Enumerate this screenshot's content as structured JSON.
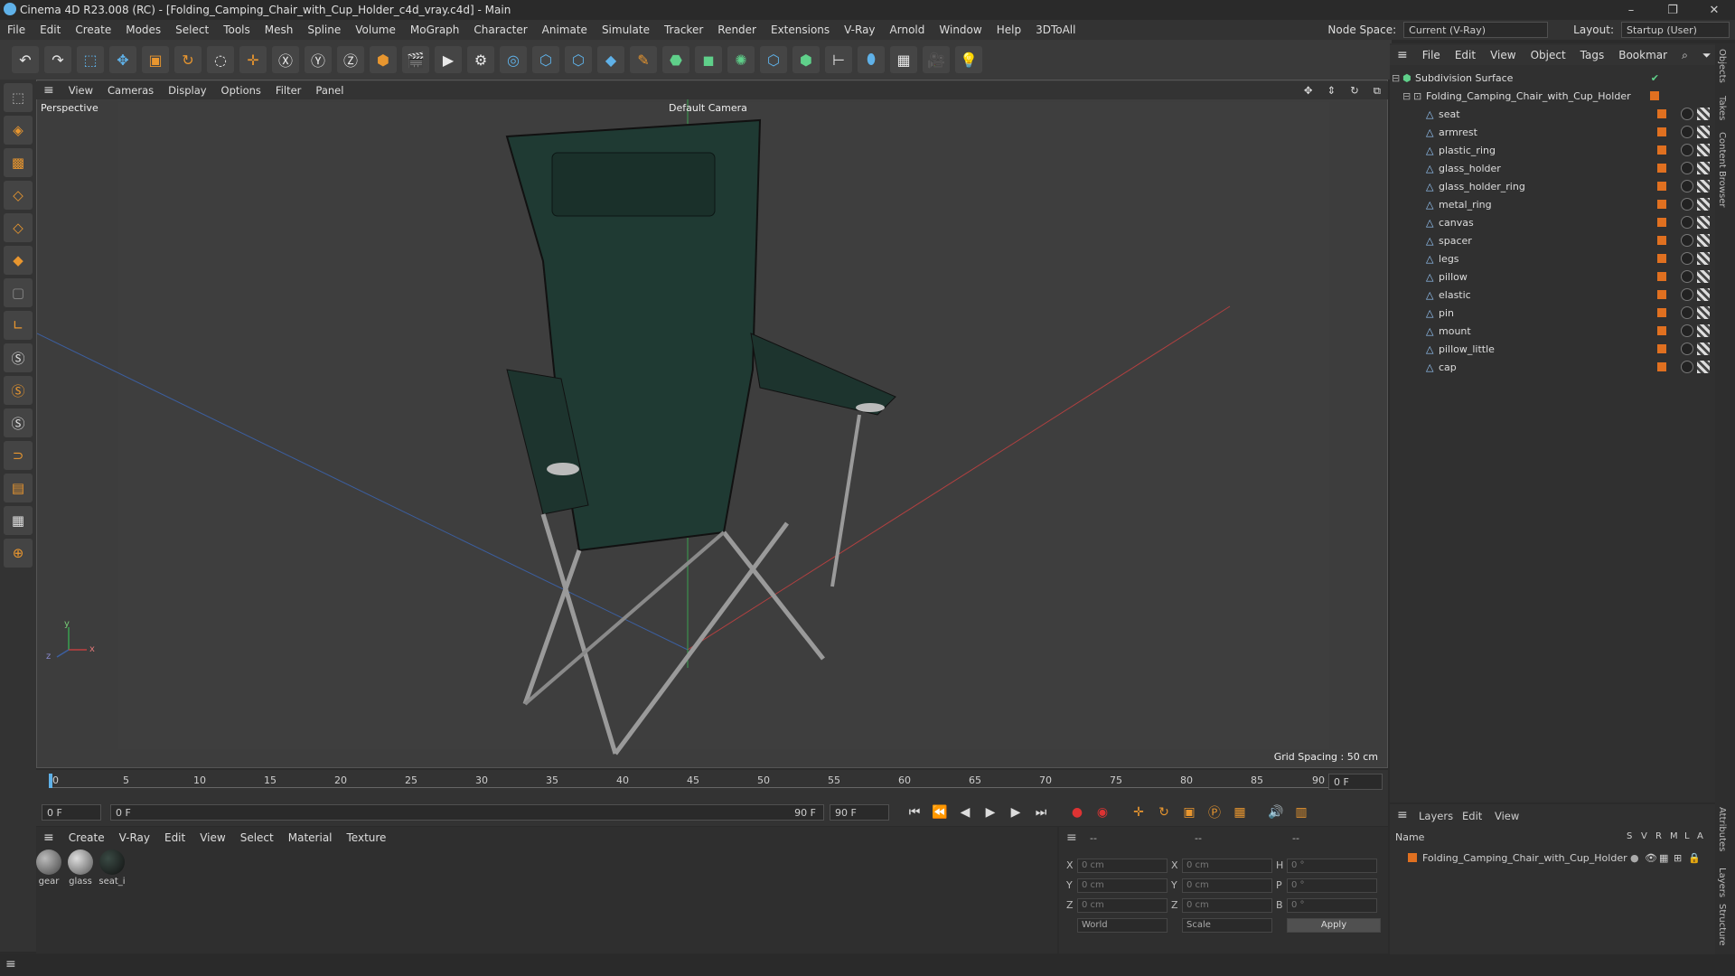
{
  "window": {
    "title": "Cinema 4D R23.008 (RC) - [Folding_Camping_Chair_with_Cup_Holder_c4d_vray.c4d] - Main",
    "minimize": "–",
    "restore": "❐",
    "close": "✕"
  },
  "menu": [
    "File",
    "Edit",
    "Create",
    "Modes",
    "Select",
    "Tools",
    "Mesh",
    "Spline",
    "Volume",
    "MoGraph",
    "Character",
    "Animate",
    "Simulate",
    "Tracker",
    "Render",
    "Extensions",
    "V-Ray",
    "Arnold",
    "Window",
    "Help",
    "3DToAll"
  ],
  "nodespace": {
    "label": "Node Space:",
    "value": "Current (V-Ray)"
  },
  "layout": {
    "label": "Layout:",
    "value": "Startup (User)"
  },
  "viewport": {
    "menu": [
      "View",
      "Cameras",
      "Display",
      "Options",
      "Filter",
      "Panel"
    ],
    "name": "Perspective",
    "camera": "Default Camera",
    "grid": "Grid Spacing : 50 cm",
    "axes": {
      "x": "x",
      "y": "y",
      "z": "z"
    }
  },
  "objects": {
    "menu": [
      "File",
      "Edit",
      "View",
      "Object",
      "Tags",
      "Bookmar"
    ],
    "root": "Subdivision Surface",
    "group": "Folding_Camping_Chair_with_Cup_Holder",
    "children": [
      "seat",
      "armrest",
      "plastic_ring",
      "glass_holder",
      "glass_holder_ring",
      "metal_ring",
      "canvas",
      "spacer",
      "legs",
      "pillow",
      "elastic",
      "pin",
      "mount",
      "pillow_little",
      "cap"
    ]
  },
  "side_tabs": [
    "Objects",
    "Takes",
    "Content Browser",
    "Attributes",
    "Layers",
    "Structure"
  ],
  "timeline": {
    "ticks": [
      "0",
      "5",
      "10",
      "15",
      "20",
      "25",
      "30",
      "35",
      "40",
      "45",
      "50",
      "55",
      "60",
      "65",
      "70",
      "75",
      "80",
      "85",
      "90"
    ],
    "frame_end_right": "0 F"
  },
  "playback": {
    "current": "0 F",
    "start": "0 F",
    "end": "90 F",
    "end2": "90 F"
  },
  "materials": {
    "menu": [
      "Create",
      "V-Ray",
      "Edit",
      "View",
      "Select",
      "Material",
      "Texture"
    ],
    "items": [
      {
        "name": "gear",
        "color": "#777"
      },
      {
        "name": "glass",
        "color": "#8a8a8a"
      },
      {
        "name": "seat_i",
        "color": "#1e2a26"
      }
    ]
  },
  "coords": {
    "x": "0 cm",
    "y": "0 cm",
    "z": "0 cm",
    "sx": "0 cm",
    "sy": "0 cm",
    "sz": "0 cm",
    "h": "0 °",
    "p": "0 °",
    "b": "0 °",
    "world": "World",
    "scale": "Scale",
    "apply": "Apply",
    "sep": "--"
  },
  "layers": {
    "menu": [
      "Layers",
      "Edit",
      "View"
    ],
    "header": {
      "name": "Name",
      "cols": [
        "S",
        "V",
        "R",
        "M",
        "L",
        "A"
      ]
    },
    "rows": [
      "Folding_Camping_Chair_with_Cup_Holder"
    ]
  }
}
